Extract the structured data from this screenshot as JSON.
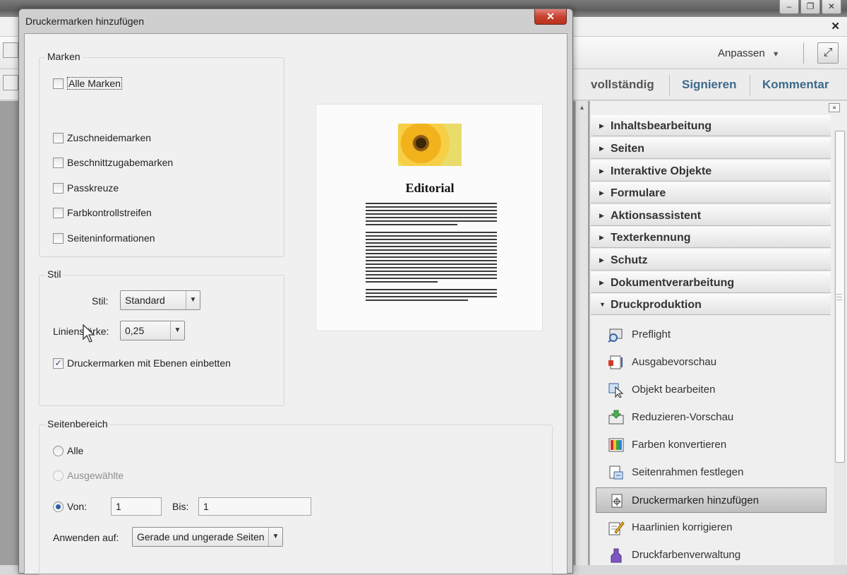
{
  "app": {
    "winbtn_minimize": "–",
    "winbtn_restore": "❐",
    "winbtn_close": "✕",
    "close_x": "✕",
    "toolbar_customize": "Anpassen",
    "tabs": [
      "vollständig",
      "Signieren",
      "Kommentar"
    ]
  },
  "dialog": {
    "title": "Druckermarken hinzufügen",
    "close": "✕",
    "marken": {
      "title": "Marken",
      "all": {
        "label": "Alle Marken",
        "checked": false
      },
      "items": [
        {
          "label": "Zuschneidemarken",
          "checked": false
        },
        {
          "label": "Beschnittzugabemarken",
          "checked": false
        },
        {
          "label": "Passkreuze",
          "checked": false
        },
        {
          "label": "Farbkontrollstreifen",
          "checked": false
        },
        {
          "label": "Seiteninformationen",
          "checked": false
        }
      ]
    },
    "stil": {
      "title": "Stil",
      "style_label": "Stil:",
      "style_value": "Standard",
      "linewidth_label": "Linienstärke:",
      "linewidth_value": "0,25",
      "embed_label": "Druckermarken mit Ebenen einbetten",
      "embed_checked": true
    },
    "preview": {
      "title": "Editorial"
    },
    "seitenbereich": {
      "title": "Seitenbereich",
      "all": "Alle",
      "selected": "Ausgewählte",
      "from_label": "Von:",
      "from_value": "1",
      "to_label": "Bis:",
      "to_value": "1",
      "apply_label": "Anwenden auf:",
      "apply_value": "Gerade und ungerade Seiten"
    }
  },
  "panel": {
    "sections": [
      "Inhaltsbearbeitung",
      "Seiten",
      "Interaktive Objekte",
      "Formulare",
      "Aktionsassistent",
      "Texterkennung",
      "Schutz",
      "Dokumentverarbeitung",
      "Druckproduktion"
    ],
    "expanded_section": "Druckproduktion",
    "tools": [
      {
        "label": "Preflight",
        "icon": "preflight-icon"
      },
      {
        "label": "Ausgabevorschau",
        "icon": "output-preview-icon"
      },
      {
        "label": "Objekt bearbeiten",
        "icon": "edit-object-icon"
      },
      {
        "label": "Reduzieren-Vorschau",
        "icon": "flattener-preview-icon"
      },
      {
        "label": "Farben konvertieren",
        "icon": "convert-colors-icon"
      },
      {
        "label": "Seitenrahmen festlegen",
        "icon": "set-page-boxes-icon"
      },
      {
        "label": "Druckermarken hinzufügen",
        "icon": "add-printer-marks-icon",
        "selected": true
      },
      {
        "label": "Haarlinien korrigieren",
        "icon": "fix-hairlines-icon"
      },
      {
        "label": "Druckfarbenverwaltung",
        "icon": "ink-manager-icon"
      }
    ]
  },
  "colors": {
    "tab_blue": "#3d6a8a",
    "close_red": "#c6432f",
    "selected_item": "#c8c8c8"
  }
}
